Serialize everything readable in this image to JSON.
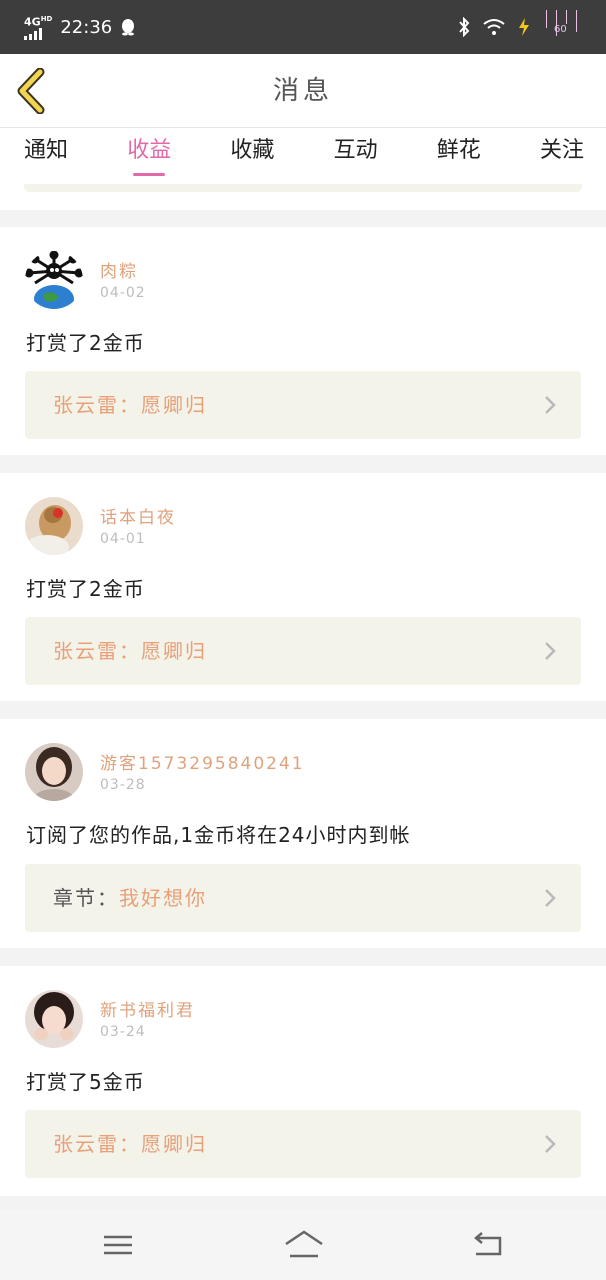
{
  "status_bar": {
    "network": "4G",
    "network_suffix": "HD",
    "time": "22:36",
    "battery_text": "60"
  },
  "header": {
    "title": "消息"
  },
  "tabs": [
    {
      "label": "通知",
      "active": false
    },
    {
      "label": "收益",
      "active": true
    },
    {
      "label": "收藏",
      "active": false
    },
    {
      "label": "互动",
      "active": false
    },
    {
      "label": "鲜花",
      "active": false
    },
    {
      "label": "关注",
      "active": false
    }
  ],
  "messages": [
    {
      "user": "肉粽",
      "date": "04-02",
      "text": "打赏了2金币",
      "work_label": "张云雷：",
      "work_title": "愿卿归"
    },
    {
      "user": "话本白夜",
      "date": "04-01",
      "text": "打赏了2金币",
      "work_label": "张云雷：",
      "work_title": "愿卿归"
    },
    {
      "user": "游客1573295840241",
      "date": "03-28",
      "text": "订阅了您的作品,1金币将在24小时内到帐",
      "work_label": "章节：",
      "work_title": "我好想你"
    },
    {
      "user": "新书福利君",
      "date": "03-24",
      "text": "打赏了5金币",
      "work_label": "张云雷：",
      "work_title": "愿卿归"
    }
  ],
  "colors": {
    "accent": "#e26aa8",
    "username": "#e0a27c",
    "work_bg": "#f4f3ea"
  }
}
